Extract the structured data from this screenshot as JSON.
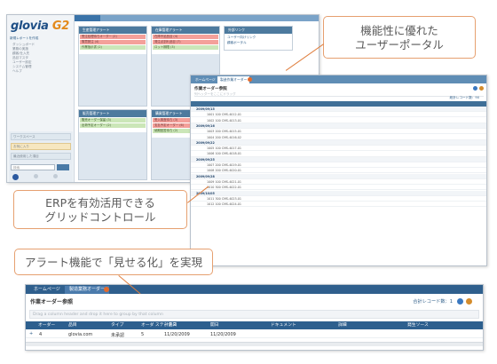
{
  "callouts": {
    "portal": [
      "機能性に優れた",
      "ユーザーポータル"
    ],
    "grid": [
      "ERPを有効活用できる",
      "グリッドコントロール"
    ],
    "alert": "アラート機能で「見せる化」を実現"
  },
  "portal": {
    "logo_main": "glovia",
    "logo_suffix": "G2",
    "tab_label": "ホームページ",
    "side_items": [
      "新規レポートを作成",
      "ダッシュボード",
      "業務の実施",
      "顧客/仕入先",
      "品目マスタ",
      "ユーザー設定",
      "システム管理",
      "ヘルプ"
    ],
    "panels": [
      {
        "title": "生産管理アラート",
        "rows": [
          {
            "t": "受注処理待ちオーダー (2)",
            "c": "pink"
          },
          {
            "t": "購買発注 (4)",
            "c": "pink"
          },
          {
            "t": "作業指示書 (2)",
            "c": "green"
          }
        ]
      },
      {
        "title": "在庫管理アラート",
        "rows": [
          {
            "t": "在庫不足品目 (4)",
            "c": "pink"
          },
          {
            "t": "発注点割れ品目 (7)",
            "c": "pink"
          },
          {
            "t": "ロット期限 (3)",
            "c": "green"
          }
        ]
      },
      {
        "title": "販売管理アラート",
        "rows": [
          {
            "t": "販売オーダー保留 (3)",
            "c": "green"
          },
          {
            "t": "出荷予定オーダー (2)",
            "c": "green"
          }
        ]
      },
      {
        "title": "購買管理アラート",
        "rows": [
          {
            "t": "受入検査待ち (3)",
            "c": "pink"
          },
          {
            "t": "支払予定オーダー (6)",
            "c": "pink"
          },
          {
            "t": "納期回答待ち (2)",
            "c": "green"
          }
        ]
      }
    ],
    "links_title": "外部リンク",
    "links": [
      "ユーザー向けリンク",
      "顧客ポータル"
    ],
    "side_bottom": [
      "ワークスペース",
      "お気に入り",
      "最近使用した項目"
    ],
    "search_placeholder": "検索"
  },
  "grid": {
    "tabs": [
      "ホームページ",
      "製造作業オーダー"
    ],
    "title": "作業オーダー参照",
    "record_text": "総計レコード数：90",
    "group_hint": "列ヘッダーをここにドラッグ",
    "groups": [
      "2009/09/15",
      "2009/09/16",
      "2009/09/22",
      "2009/09/25",
      "2009/09/28",
      "2009/10/05"
    ],
    "rows": [
      "1001 100 CMS-4012-01",
      "1002 100 CMS-4013-01",
      "1003 200 CMS-4015-01",
      "1004 200 CMS-4016-02",
      "1005 100 CMS-4017-01",
      "1006 100 CMS-4018-01",
      "1007 200 CMS-4019-01",
      "1008 200 CMS-4020-01",
      "1009 100 CMS-4021-01",
      "1010 300 CMS-4022-01",
      "1011 300 CMS-4023-01",
      "1012 100 CMS-4024-01"
    ]
  },
  "bottom": {
    "tabs": [
      "ホームページ",
      "製造業務オーダー"
    ],
    "title": "作業オーダー参照",
    "record_label": "合計レコード数：1",
    "group_hint": "Drag a column header and drop it here to group by that column",
    "headers": [
      "オーダー",
      "品目",
      "タイプ",
      "オーダ ステータス",
      "計画日",
      "開日",
      "ドキュメント",
      "詳細",
      "発生ソース"
    ],
    "row": [
      "4",
      "glovia.com",
      "未承認",
      "5",
      "11/20/2009",
      "11/20/2009"
    ]
  },
  "colors": {
    "accent": "#e08040",
    "header_blue": "#2d5f8e",
    "pink_alert": "#f4a09a",
    "green_alert": "#cbe6b8"
  }
}
